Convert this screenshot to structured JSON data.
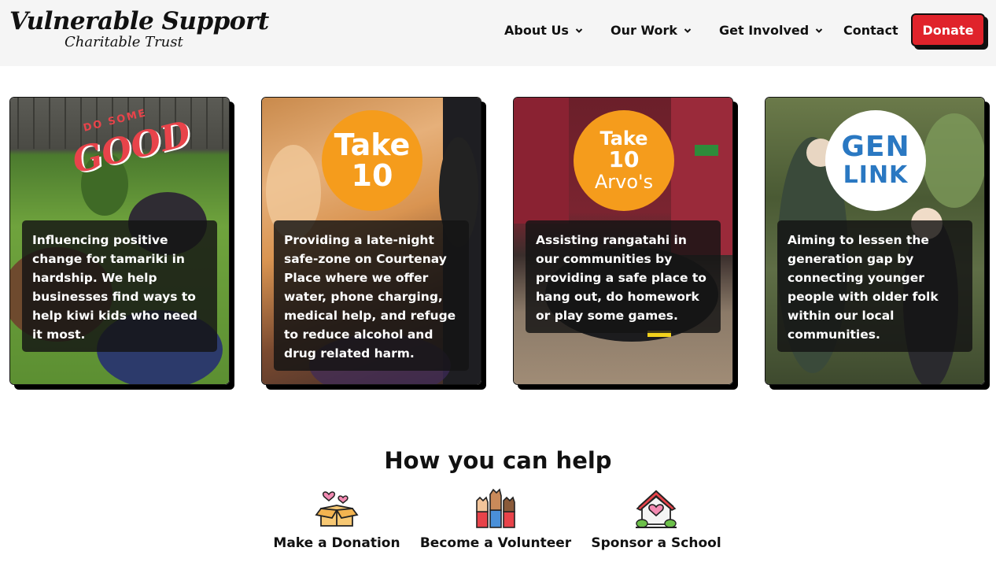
{
  "logo": {
    "title": "Vulnerable Support",
    "subtitle": "Charitable Trust"
  },
  "nav": {
    "items": [
      {
        "label": "About Us",
        "has_dropdown": true
      },
      {
        "label": "Our Work",
        "has_dropdown": true
      },
      {
        "label": "Get Involved",
        "has_dropdown": true
      },
      {
        "label": "Contact",
        "has_dropdown": false
      }
    ],
    "donate_label": "Donate"
  },
  "colors": {
    "accent_red": "#e0232b",
    "badge_orange": "#f59c1c",
    "header_bg": "#f5f5f5"
  },
  "cards": [
    {
      "logo_text_small": "DO SOME",
      "logo_text_big": "GOOD",
      "text": "Influencing positive change for tamariki in hardship. We help businesses find ways to help kiwi kids who need it most."
    },
    {
      "badge_line1": "Take",
      "badge_line2": "10",
      "text": "Providing a late-night safe-zone on Courtenay Place where we offer water, phone charging, medical help, and refuge to reduce alcohol and drug related harm."
    },
    {
      "badge_line1": "Take",
      "badge_line2": "10",
      "badge_line3": "Arvo's",
      "text": "Assisting rangatahi in our communities by providing a safe place to hang out, do homework or play some games."
    },
    {
      "logo_line1": "GEN",
      "logo_line2": "LINK",
      "text": "Aiming to lessen the generation gap by connecting younger people with older folk within our local communities."
    }
  ],
  "help": {
    "title": "How you can help",
    "items": [
      {
        "label": "Make a Donation",
        "icon": "donation-box-icon"
      },
      {
        "label": "Become a Volunteer",
        "icon": "raised-hands-icon"
      },
      {
        "label": "Sponsor a School",
        "icon": "house-heart-icon"
      }
    ]
  }
}
